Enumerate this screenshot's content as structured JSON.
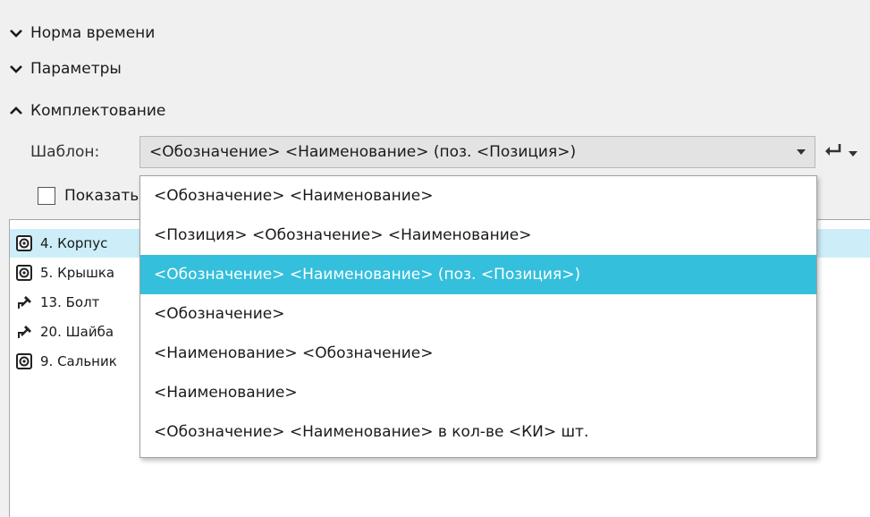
{
  "sections": [
    {
      "label": "Норма времени",
      "state": "collapsed",
      "icon": "chevron-down-icon"
    },
    {
      "label": "Параметры",
      "state": "collapsed",
      "icon": "chevron-down-icon"
    },
    {
      "label": "Комплектование",
      "state": "expanded",
      "icon": "chevron-up-icon"
    }
  ],
  "template": {
    "label": "Шаблон:",
    "value": "<Обозначение> <Наименование> (поз. <Позиция>)",
    "insert_icon": "insert-enter-icon"
  },
  "show_checkbox": {
    "label": "Показать",
    "checked": false
  },
  "list": [
    {
      "text": "4. Корпус",
      "icon": "part-icon",
      "selected": true
    },
    {
      "text": "5. Крышка",
      "icon": "part-icon",
      "selected": false
    },
    {
      "text": "13. Болт",
      "icon": "standard-part-icon",
      "selected": false
    },
    {
      "text": "20. Шайба",
      "icon": "standard-part-icon",
      "selected": false
    },
    {
      "text": "9. Сальник",
      "icon": "part-icon",
      "selected": false
    }
  ],
  "dropdown_options": [
    {
      "text": "<Обозначение> <Наименование>",
      "selected": false
    },
    {
      "text": "<Позиция> <Обозначение> <Наименование>",
      "selected": false
    },
    {
      "text": "<Обозначение> <Наименование> (поз. <Позиция>)",
      "selected": true
    },
    {
      "text": "<Обозначение>",
      "selected": false
    },
    {
      "text": "<Наименование> <Обозначение>",
      "selected": false
    },
    {
      "text": "<Наименование>",
      "selected": false
    },
    {
      "text": "<Обозначение> <Наименование> в кол-ве <КИ> шт.",
      "selected": false
    }
  ],
  "colors": {
    "selection_accent": "#34bfdc",
    "list_selection": "#cdeef8",
    "panel_background": "#f0f0f0"
  }
}
